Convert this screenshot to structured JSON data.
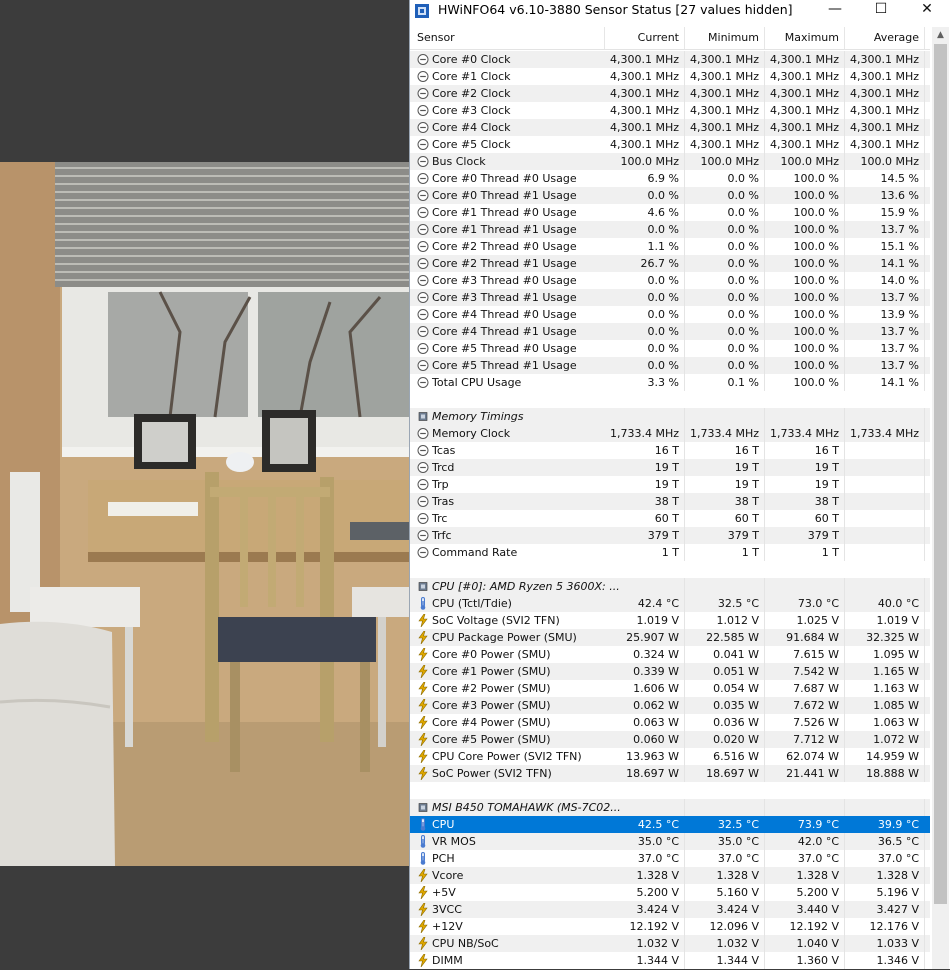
{
  "window": {
    "title": "HWiNFO64 v6.10-3880 Sensor Status [27 values hidden]",
    "controls": {
      "minimize": "—",
      "maximize": "☐",
      "close": "✕"
    }
  },
  "columns": {
    "sensor": "Sensor",
    "current": "Current",
    "minimum": "Minimum",
    "maximum": "Maximum",
    "average": "Average"
  },
  "colors": {
    "selection": "#0078d7",
    "alt_row": "#f0f0f0",
    "thermometer": "#4a7bd0",
    "bolt": "#e0a800"
  },
  "rows": [
    {
      "icon": "clock-icon",
      "label": "Core #0 Clock",
      "cur": "4,300.1 MHz",
      "min": "4,300.1 MHz",
      "max": "4,300.1 MHz",
      "avg": "4,300.1 MHz"
    },
    {
      "icon": "clock-icon",
      "label": "Core #1 Clock",
      "cur": "4,300.1 MHz",
      "min": "4,300.1 MHz",
      "max": "4,300.1 MHz",
      "avg": "4,300.1 MHz"
    },
    {
      "icon": "clock-icon",
      "label": "Core #2 Clock",
      "cur": "4,300.1 MHz",
      "min": "4,300.1 MHz",
      "max": "4,300.1 MHz",
      "avg": "4,300.1 MHz"
    },
    {
      "icon": "clock-icon",
      "label": "Core #3 Clock",
      "cur": "4,300.1 MHz",
      "min": "4,300.1 MHz",
      "max": "4,300.1 MHz",
      "avg": "4,300.1 MHz"
    },
    {
      "icon": "clock-icon",
      "label": "Core #4 Clock",
      "cur": "4,300.1 MHz",
      "min": "4,300.1 MHz",
      "max": "4,300.1 MHz",
      "avg": "4,300.1 MHz"
    },
    {
      "icon": "clock-icon",
      "label": "Core #5 Clock",
      "cur": "4,300.1 MHz",
      "min": "4,300.1 MHz",
      "max": "4,300.1 MHz",
      "avg": "4,300.1 MHz"
    },
    {
      "icon": "clock-icon",
      "label": "Bus Clock",
      "cur": "100.0 MHz",
      "min": "100.0 MHz",
      "max": "100.0 MHz",
      "avg": "100.0 MHz"
    },
    {
      "icon": "clock-icon",
      "label": "Core #0 Thread #0 Usage",
      "cur": "6.9 %",
      "min": "0.0 %",
      "max": "100.0 %",
      "avg": "14.5 %"
    },
    {
      "icon": "clock-icon",
      "label": "Core #0 Thread #1 Usage",
      "cur": "0.0 %",
      "min": "0.0 %",
      "max": "100.0 %",
      "avg": "13.6 %"
    },
    {
      "icon": "clock-icon",
      "label": "Core #1 Thread #0 Usage",
      "cur": "4.6 %",
      "min": "0.0 %",
      "max": "100.0 %",
      "avg": "15.9 %"
    },
    {
      "icon": "clock-icon",
      "label": "Core #1 Thread #1 Usage",
      "cur": "0.0 %",
      "min": "0.0 %",
      "max": "100.0 %",
      "avg": "13.7 %"
    },
    {
      "icon": "clock-icon",
      "label": "Core #2 Thread #0 Usage",
      "cur": "1.1 %",
      "min": "0.0 %",
      "max": "100.0 %",
      "avg": "15.1 %"
    },
    {
      "icon": "clock-icon",
      "label": "Core #2 Thread #1 Usage",
      "cur": "26.7 %",
      "min": "0.0 %",
      "max": "100.0 %",
      "avg": "14.1 %"
    },
    {
      "icon": "clock-icon",
      "label": "Core #3 Thread #0 Usage",
      "cur": "0.0 %",
      "min": "0.0 %",
      "max": "100.0 %",
      "avg": "14.0 %"
    },
    {
      "icon": "clock-icon",
      "label": "Core #3 Thread #1 Usage",
      "cur": "0.0 %",
      "min": "0.0 %",
      "max": "100.0 %",
      "avg": "13.7 %"
    },
    {
      "icon": "clock-icon",
      "label": "Core #4 Thread #0 Usage",
      "cur": "0.0 %",
      "min": "0.0 %",
      "max": "100.0 %",
      "avg": "13.9 %"
    },
    {
      "icon": "clock-icon",
      "label": "Core #4 Thread #1 Usage",
      "cur": "0.0 %",
      "min": "0.0 %",
      "max": "100.0 %",
      "avg": "13.7 %"
    },
    {
      "icon": "clock-icon",
      "label": "Core #5 Thread #0 Usage",
      "cur": "0.0 %",
      "min": "0.0 %",
      "max": "100.0 %",
      "avg": "13.7 %"
    },
    {
      "icon": "clock-icon",
      "label": "Core #5 Thread #1 Usage",
      "cur": "0.0 %",
      "min": "0.0 %",
      "max": "100.0 %",
      "avg": "13.7 %"
    },
    {
      "icon": "clock-icon",
      "label": "Total CPU Usage",
      "cur": "3.3 %",
      "min": "0.1 %",
      "max": "100.0 %",
      "avg": "14.1 %"
    },
    {
      "type": "spacer"
    },
    {
      "type": "group",
      "icon": "chip-icon",
      "label": "Memory Timings"
    },
    {
      "icon": "clock-icon",
      "label": "Memory Clock",
      "cur": "1,733.4 MHz",
      "min": "1,733.4 MHz",
      "max": "1,733.4 MHz",
      "avg": "1,733.4 MHz"
    },
    {
      "icon": "clock-icon",
      "label": "Tcas",
      "cur": "16 T",
      "min": "16 T",
      "max": "16 T",
      "avg": ""
    },
    {
      "icon": "clock-icon",
      "label": "Trcd",
      "cur": "19 T",
      "min": "19 T",
      "max": "19 T",
      "avg": ""
    },
    {
      "icon": "clock-icon",
      "label": "Trp",
      "cur": "19 T",
      "min": "19 T",
      "max": "19 T",
      "avg": ""
    },
    {
      "icon": "clock-icon",
      "label": "Tras",
      "cur": "38 T",
      "min": "38 T",
      "max": "38 T",
      "avg": ""
    },
    {
      "icon": "clock-icon",
      "label": "Trc",
      "cur": "60 T",
      "min": "60 T",
      "max": "60 T",
      "avg": ""
    },
    {
      "icon": "clock-icon",
      "label": "Trfc",
      "cur": "379 T",
      "min": "379 T",
      "max": "379 T",
      "avg": ""
    },
    {
      "icon": "clock-icon",
      "label": "Command Rate",
      "cur": "1 T",
      "min": "1 T",
      "max": "1 T",
      "avg": ""
    },
    {
      "type": "spacer"
    },
    {
      "type": "group",
      "icon": "chip-icon",
      "label": "CPU [#0]: AMD Ryzen 5 3600X: ..."
    },
    {
      "icon": "thermometer-icon",
      "label": "CPU (Tctl/Tdie)",
      "cur": "42.4 °C",
      "min": "32.5 °C",
      "max": "73.0 °C",
      "avg": "40.0 °C"
    },
    {
      "icon": "bolt-icon",
      "label": "SoC Voltage (SVI2 TFN)",
      "cur": "1.019 V",
      "min": "1.012 V",
      "max": "1.025 V",
      "avg": "1.019 V"
    },
    {
      "icon": "bolt-icon",
      "label": "CPU Package Power (SMU)",
      "cur": "25.907 W",
      "min": "22.585 W",
      "max": "91.684 W",
      "avg": "32.325 W"
    },
    {
      "icon": "bolt-icon",
      "label": "Core #0 Power (SMU)",
      "cur": "0.324 W",
      "min": "0.041 W",
      "max": "7.615 W",
      "avg": "1.095 W"
    },
    {
      "icon": "bolt-icon",
      "label": "Core #1 Power (SMU)",
      "cur": "0.339 W",
      "min": "0.051 W",
      "max": "7.542 W",
      "avg": "1.165 W"
    },
    {
      "icon": "bolt-icon",
      "label": "Core #2 Power (SMU)",
      "cur": "1.606 W",
      "min": "0.054 W",
      "max": "7.687 W",
      "avg": "1.163 W"
    },
    {
      "icon": "bolt-icon",
      "label": "Core #3 Power (SMU)",
      "cur": "0.062 W",
      "min": "0.035 W",
      "max": "7.672 W",
      "avg": "1.085 W"
    },
    {
      "icon": "bolt-icon",
      "label": "Core #4 Power (SMU)",
      "cur": "0.063 W",
      "min": "0.036 W",
      "max": "7.526 W",
      "avg": "1.063 W"
    },
    {
      "icon": "bolt-icon",
      "label": "Core #5 Power (SMU)",
      "cur": "0.060 W",
      "min": "0.020 W",
      "max": "7.712 W",
      "avg": "1.072 W"
    },
    {
      "icon": "bolt-icon",
      "label": "CPU Core Power (SVI2 TFN)",
      "cur": "13.963 W",
      "min": "6.516 W",
      "max": "62.074 W",
      "avg": "14.959 W"
    },
    {
      "icon": "bolt-icon",
      "label": "SoC Power (SVI2 TFN)",
      "cur": "18.697 W",
      "min": "18.697 W",
      "max": "21.441 W",
      "avg": "18.888 W"
    },
    {
      "type": "spacer"
    },
    {
      "type": "group",
      "icon": "chip-icon",
      "label": "MSI B450 TOMAHAWK (MS-7C02..."
    },
    {
      "icon": "thermometer-icon",
      "label": "CPU",
      "cur": "42.5 °C",
      "min": "32.5 °C",
      "max": "73.9 °C",
      "avg": "39.9 °C",
      "selected": true
    },
    {
      "icon": "thermometer-icon",
      "label": "VR MOS",
      "cur": "35.0 °C",
      "min": "35.0 °C",
      "max": "42.0 °C",
      "avg": "36.5 °C"
    },
    {
      "icon": "thermometer-icon",
      "label": "PCH",
      "cur": "37.0 °C",
      "min": "37.0 °C",
      "max": "37.0 °C",
      "avg": "37.0 °C"
    },
    {
      "icon": "bolt-icon",
      "label": "Vcore",
      "cur": "1.328 V",
      "min": "1.328 V",
      "max": "1.328 V",
      "avg": "1.328 V"
    },
    {
      "icon": "bolt-icon",
      "label": "+5V",
      "cur": "5.200 V",
      "min": "5.160 V",
      "max": "5.200 V",
      "avg": "5.196 V"
    },
    {
      "icon": "bolt-icon",
      "label": "3VCC",
      "cur": "3.424 V",
      "min": "3.424 V",
      "max": "3.440 V",
      "avg": "3.427 V"
    },
    {
      "icon": "bolt-icon",
      "label": "+12V",
      "cur": "12.192 V",
      "min": "12.096 V",
      "max": "12.192 V",
      "avg": "12.176 V"
    },
    {
      "icon": "bolt-icon",
      "label": "CPU NB/SoC",
      "cur": "1.032 V",
      "min": "1.032 V",
      "max": "1.040 V",
      "avg": "1.033 V"
    },
    {
      "icon": "bolt-icon",
      "label": "DIMM",
      "cur": "1.344 V",
      "min": "1.344 V",
      "max": "1.360 V",
      "avg": "1.346 V"
    }
  ]
}
